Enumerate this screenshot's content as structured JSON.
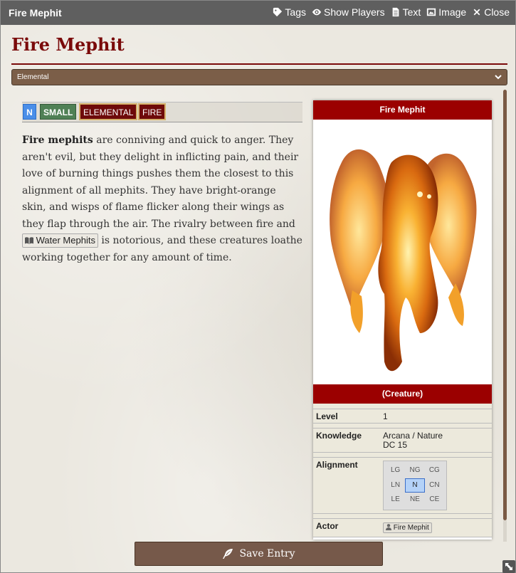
{
  "window": {
    "title": "Fire Mephit",
    "actions": [
      {
        "label": "Tags",
        "icon": "tag-icon"
      },
      {
        "label": "Show Players",
        "icon": "eye-icon"
      },
      {
        "label": "Text",
        "icon": "file-text-icon"
      },
      {
        "label": "Image",
        "icon": "image-icon"
      },
      {
        "label": "Close",
        "icon": "close-icon"
      }
    ]
  },
  "page": {
    "heading": "Fire Mephit",
    "category": "Elemental"
  },
  "tags": [
    "N",
    "SMALL",
    "ELEMENTAL",
    "FIRE"
  ],
  "description": {
    "bold": "Fire mephits",
    "text1": " are conniving and quick to anger. They aren't evil, but they delight in inflicting pain, and their love of burning things pushes them the closest to this alignment of all mephits. They have bright-orange skin, and wisps of flame flicker along their wings as they flap through the air. The rivalry between fire and ",
    "link": "Water Mephits",
    "text2": " is notorious, and these creatures loathe working together for any amount of time."
  },
  "infobox": {
    "title": "Fire Mephit",
    "subtitle": "(Creature)",
    "level_label": "Level",
    "level_value": "1",
    "knowledge_label": "Knowledge",
    "knowledge_value_1": "Arcana / Nature",
    "knowledge_value_2": "DC 15",
    "alignment_label": "Alignment",
    "alignment_grid": [
      "LG",
      "NG",
      "CG",
      "LN",
      "N",
      "CN",
      "LE",
      "NE",
      "CE"
    ],
    "alignment_selected": "N",
    "actor_label": "Actor",
    "actor_value": "Fire Mephit"
  },
  "footer": {
    "save_label": "Save Entry"
  },
  "colors": {
    "titlebar": "#5f5f5f",
    "heading": "#7a0a0a",
    "infobox_header": "#9b0000",
    "button": "#76594a"
  }
}
